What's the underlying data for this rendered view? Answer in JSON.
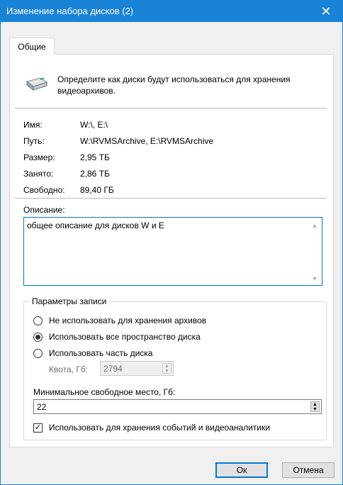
{
  "window": {
    "title": "Изменение набора дисков (2)"
  },
  "tabs": [
    {
      "label": "Общие"
    }
  ],
  "header": {
    "description_line1": "Определите как диски будут использоваться для хранения",
    "description_line2": "видеоархивов."
  },
  "info": {
    "rows": [
      {
        "label": "Имя:",
        "value": "W:\\, E:\\"
      },
      {
        "label": "Путь:",
        "value": "W:\\RVMSArchive, E:\\RVMSArchive"
      },
      {
        "label": "Размер:",
        "value": "2,95 ТБ"
      },
      {
        "label": "Занято:",
        "value": "2,86 ТБ"
      },
      {
        "label": "Свободно:",
        "value": "89,40 ГБ"
      }
    ]
  },
  "description": {
    "label": "Описание:",
    "value": "общее описание для дисков W и E"
  },
  "recording": {
    "title": "Параметры записи",
    "options": [
      {
        "label": "Не использовать для хранения архивов",
        "checked": false
      },
      {
        "label": "Использовать все пространство диска",
        "checked": true
      },
      {
        "label": "Использовать часть диска",
        "checked": false
      }
    ],
    "quota_label": "Квота, Гб:",
    "quota_value": "2794",
    "min_free_label": "Минимальное свободное место, Гб:",
    "min_free_value": "22",
    "events_checkbox_label": "Использовать для хранения событий и видеоаналитики",
    "events_checkbox_checked": true
  },
  "buttons": {
    "ok": "Ок",
    "cancel": "Отмена"
  },
  "icons": {
    "close": "close-icon",
    "drive": "hard-drive-icon",
    "checkmark": "checkmark-icon"
  },
  "colors": {
    "titlebar": "#1883d7",
    "focus_border": "#0078d7"
  }
}
